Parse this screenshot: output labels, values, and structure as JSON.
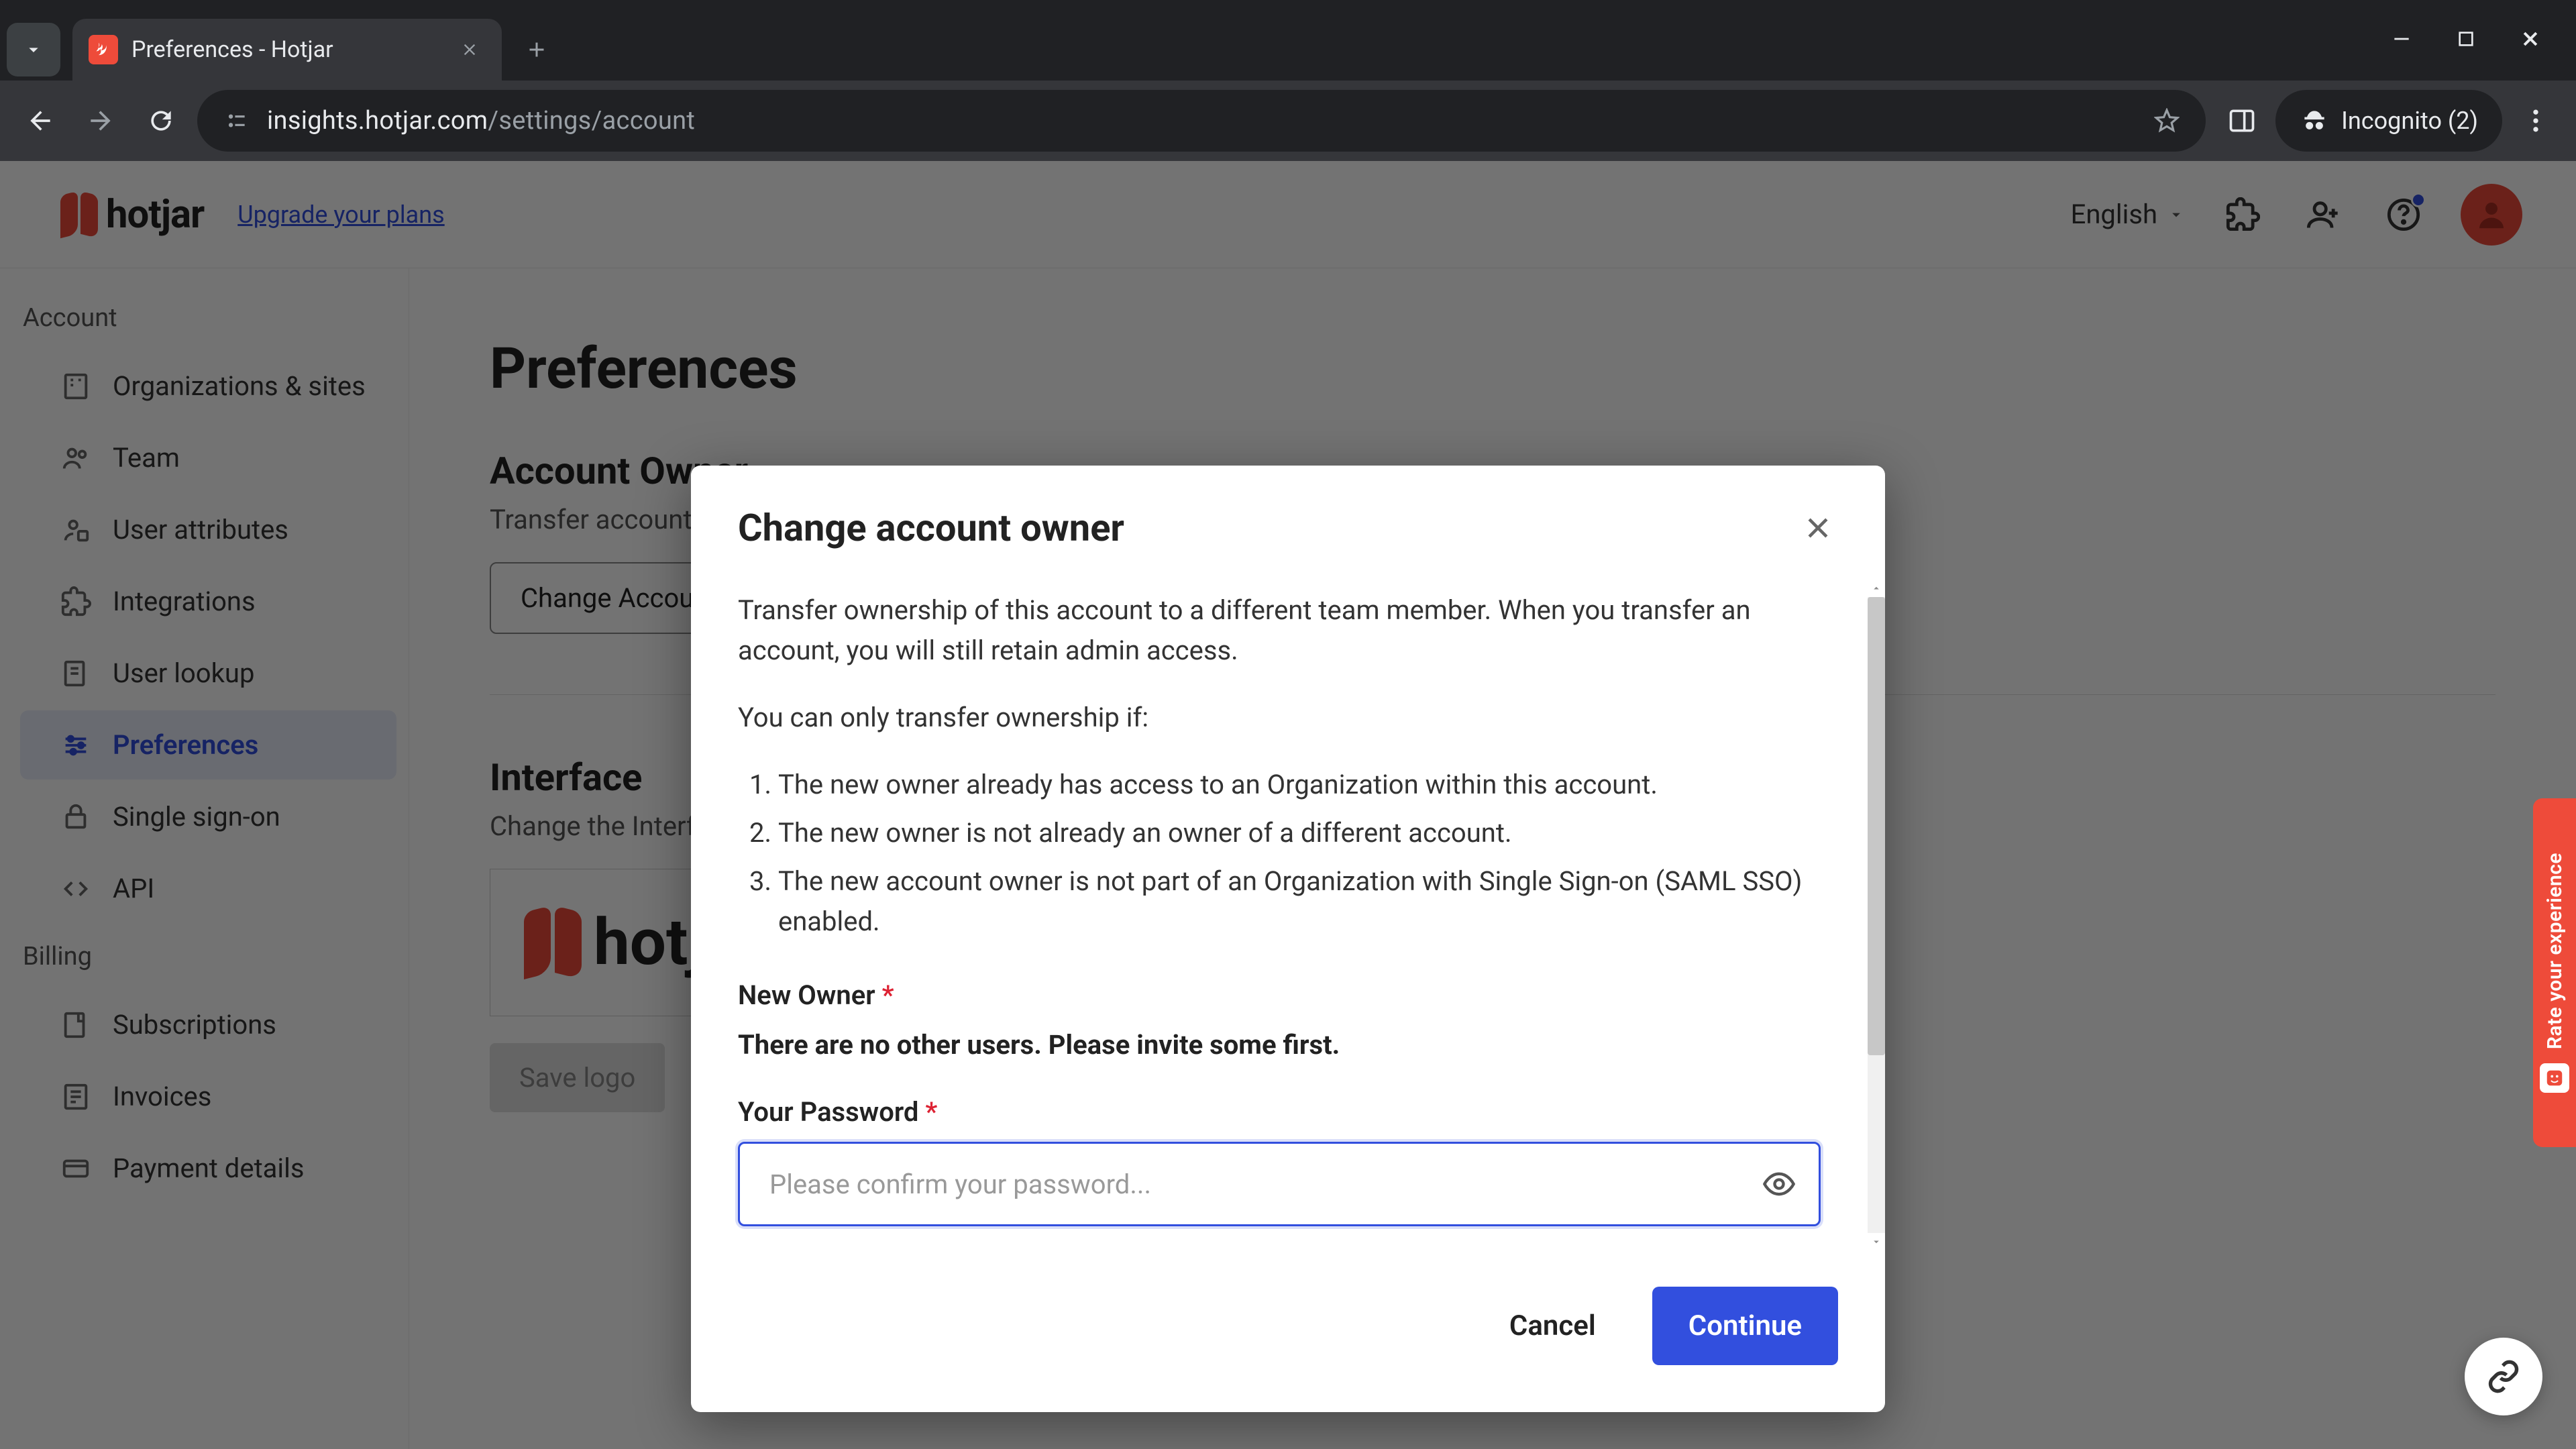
{
  "browser": {
    "tab_title": "Preferences - Hotjar",
    "url_host": "insights.hotjar.com",
    "url_path": "/settings/account",
    "incognito_label": "Incognito (2)"
  },
  "header": {
    "brand": "hotjar",
    "upgrade": "Upgrade your plans",
    "language": "English"
  },
  "sidebar": {
    "group_account": "Account",
    "group_billing": "Billing",
    "items": {
      "orgs": "Organizations & sites",
      "team": "Team",
      "user_attributes": "User attributes",
      "integrations": "Integrations",
      "user_lookup": "User lookup",
      "preferences": "Preferences",
      "sso": "Single sign-on",
      "api": "API",
      "subscriptions": "Subscriptions",
      "invoices": "Invoices",
      "payment_details": "Payment details"
    }
  },
  "page": {
    "title": "Preferences",
    "section_owner_title": "Account Owner",
    "section_owner_desc": "Transfer account ownership to another user.",
    "change_owner_btn": "Change Account Owner",
    "section_interface_title": "Interface",
    "section_interface_desc": "Change the Interface.",
    "logo_word": "hotjar",
    "save_logo_btn": "Save logo"
  },
  "modal": {
    "title": "Change account owner",
    "intro": "Transfer ownership of this account to a different team member. When you transfer an account, you will still retain admin access.",
    "rules_lead": "You can only transfer ownership if:",
    "rule1": "The new owner already has access to an Organization within this account.",
    "rule2": "The new owner is not already an owner of a different account.",
    "rule3": "The new account owner is not part of an Organization with Single Sign-on (SAML SSO) enabled.",
    "new_owner_label": "New Owner",
    "no_users": "There are no other users. Please invite some first.",
    "password_label": "Your Password",
    "password_placeholder": "Please confirm your password...",
    "cancel": "Cancel",
    "continue": "Continue"
  },
  "feedback": {
    "label": "Rate your experience"
  }
}
